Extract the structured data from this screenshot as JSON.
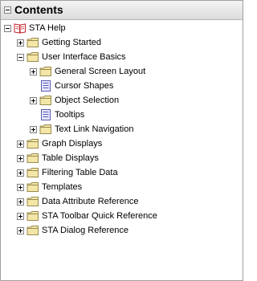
{
  "header": {
    "title": "Contents"
  },
  "tree": [
    {
      "label": "STA Help",
      "level": 0,
      "toggle": "minus",
      "icon": "book-icon"
    },
    {
      "label": "Getting Started",
      "level": 1,
      "toggle": "plus",
      "icon": "folder-icon"
    },
    {
      "label": "User Interface Basics",
      "level": 1,
      "toggle": "minus",
      "icon": "folder-icon"
    },
    {
      "label": "General Screen Layout",
      "level": 2,
      "toggle": "plus",
      "icon": "folder-icon"
    },
    {
      "label": "Cursor Shapes",
      "level": 2,
      "toggle": "",
      "icon": "page-icon"
    },
    {
      "label": "Object Selection",
      "level": 2,
      "toggle": "plus",
      "icon": "folder-icon"
    },
    {
      "label": "Tooltips",
      "level": 2,
      "toggle": "",
      "icon": "page-icon"
    },
    {
      "label": "Text Link Navigation",
      "level": 2,
      "toggle": "plus",
      "icon": "folder-icon"
    },
    {
      "label": "Graph Displays",
      "level": 1,
      "toggle": "plus",
      "icon": "folder-icon"
    },
    {
      "label": "Table Displays",
      "level": 1,
      "toggle": "plus",
      "icon": "folder-icon"
    },
    {
      "label": "Filtering Table Data",
      "level": 1,
      "toggle": "plus",
      "icon": "folder-icon"
    },
    {
      "label": "Templates",
      "level": 1,
      "toggle": "plus",
      "icon": "folder-icon"
    },
    {
      "label": "Data Attribute Reference",
      "level": 1,
      "toggle": "plus",
      "icon": "folder-icon"
    },
    {
      "label": "STA Toolbar Quick Reference",
      "level": 1,
      "toggle": "plus",
      "icon": "folder-icon"
    },
    {
      "label": "STA Dialog Reference",
      "level": 1,
      "toggle": "plus",
      "icon": "folder-icon"
    }
  ],
  "colors": {
    "folder_fill": "#f3e6a6",
    "folder_stroke": "#9a8a52",
    "page_fill": "#e8e8ff",
    "page_stroke": "#5a5ab4",
    "book_red": "#c0202a"
  }
}
